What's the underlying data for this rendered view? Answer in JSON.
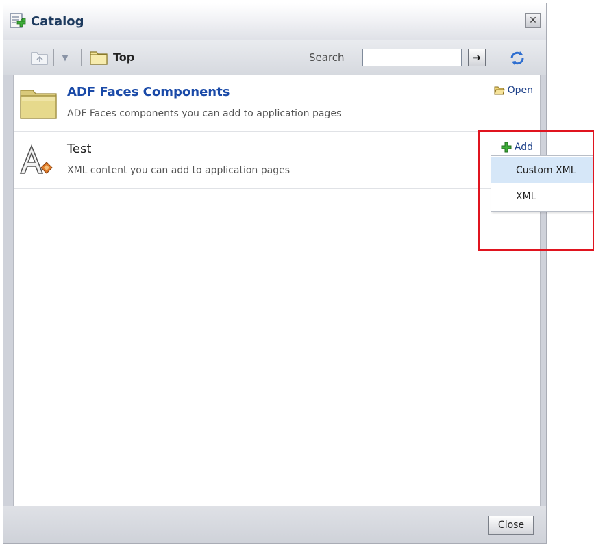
{
  "dialog": {
    "title": "Catalog",
    "close_label": "Close",
    "icons": {
      "title": "catalog-add-icon",
      "window_close": "close-icon"
    }
  },
  "toolbar": {
    "icons": {
      "up": "up-folder-icon",
      "dropdown": "chevron-down-icon",
      "location": "folder-icon",
      "go": "arrow-right-icon",
      "refresh": "refresh-icon"
    },
    "location": "Top",
    "search_label": "Search",
    "search_value": ""
  },
  "items": [
    {
      "title": "ADF Faces Components",
      "description": "ADF Faces components you can add to application pages",
      "action": "Open",
      "icon": "folder-icon",
      "action_icon": "open-folder-icon"
    },
    {
      "title": "Test",
      "description": "XML content you can add to application pages",
      "action": "Add",
      "icon": "xml-content-icon",
      "action_icon": "plus-icon"
    }
  ],
  "add_menu": {
    "items": [
      "Custom XML",
      "XML"
    ],
    "highlighted": "Custom XML"
  },
  "colors": {
    "accent_link": "#1a4aa8",
    "highlight_box": "#e0141f",
    "menu_highlight": "#d6e7f8"
  }
}
